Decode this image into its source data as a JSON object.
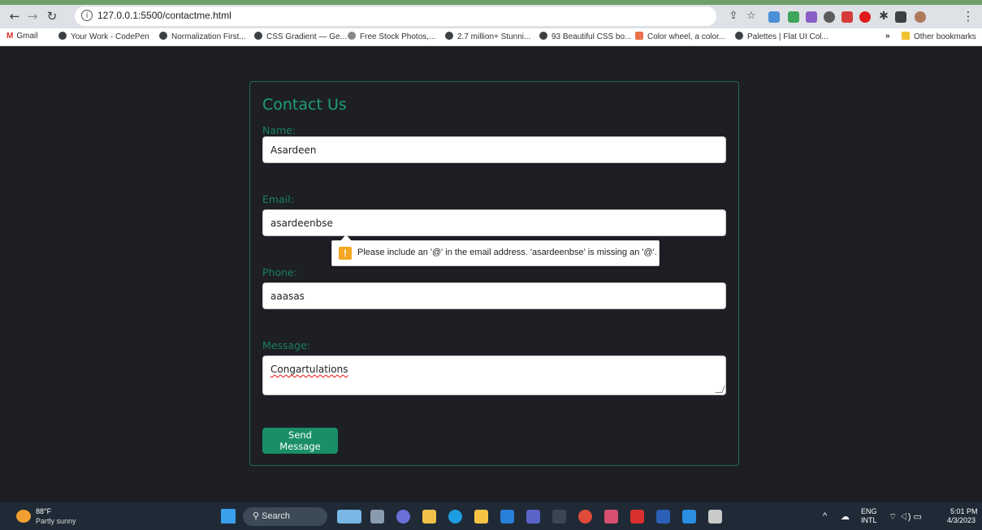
{
  "browser": {
    "url": "127.0.0.1:5500/contactme.html",
    "bookmarks": [
      "Gmail",
      "Your Work - CodePen",
      "Normalization First...",
      "CSS Gradient — Ge...",
      "Free Stock Photos,...",
      "2.7 million+ Stunni...",
      "93 Beautiful CSS bo...",
      "Color wheel, a color...",
      "Palettes | Flat UI Col...",
      "Other bookmarks"
    ],
    "chevron": "»"
  },
  "form": {
    "title": "Contact Us",
    "name_label": "Name:",
    "name_value": "Asardeen",
    "email_label": "Email:",
    "email_value": "asardeenbse",
    "phone_label": "Phone:",
    "phone_value": "aaasas",
    "message_label": "Message:",
    "message_value": "Congartulations",
    "send_label": "Send Message"
  },
  "validation": {
    "message": "Please include an '@' in the email address. 'asardeenbse' is missing an '@'."
  },
  "taskbar": {
    "temperature": "88°F",
    "weather": "Partly sunny",
    "search_label": "Search",
    "lang_top": "ENG",
    "lang_bottom": "INTL",
    "time": "5:01 PM",
    "date": "4/3/2023"
  },
  "colors": {
    "accent": "#1a8f67",
    "page_bg": "#1d1f24",
    "border": "#1f6b56"
  }
}
